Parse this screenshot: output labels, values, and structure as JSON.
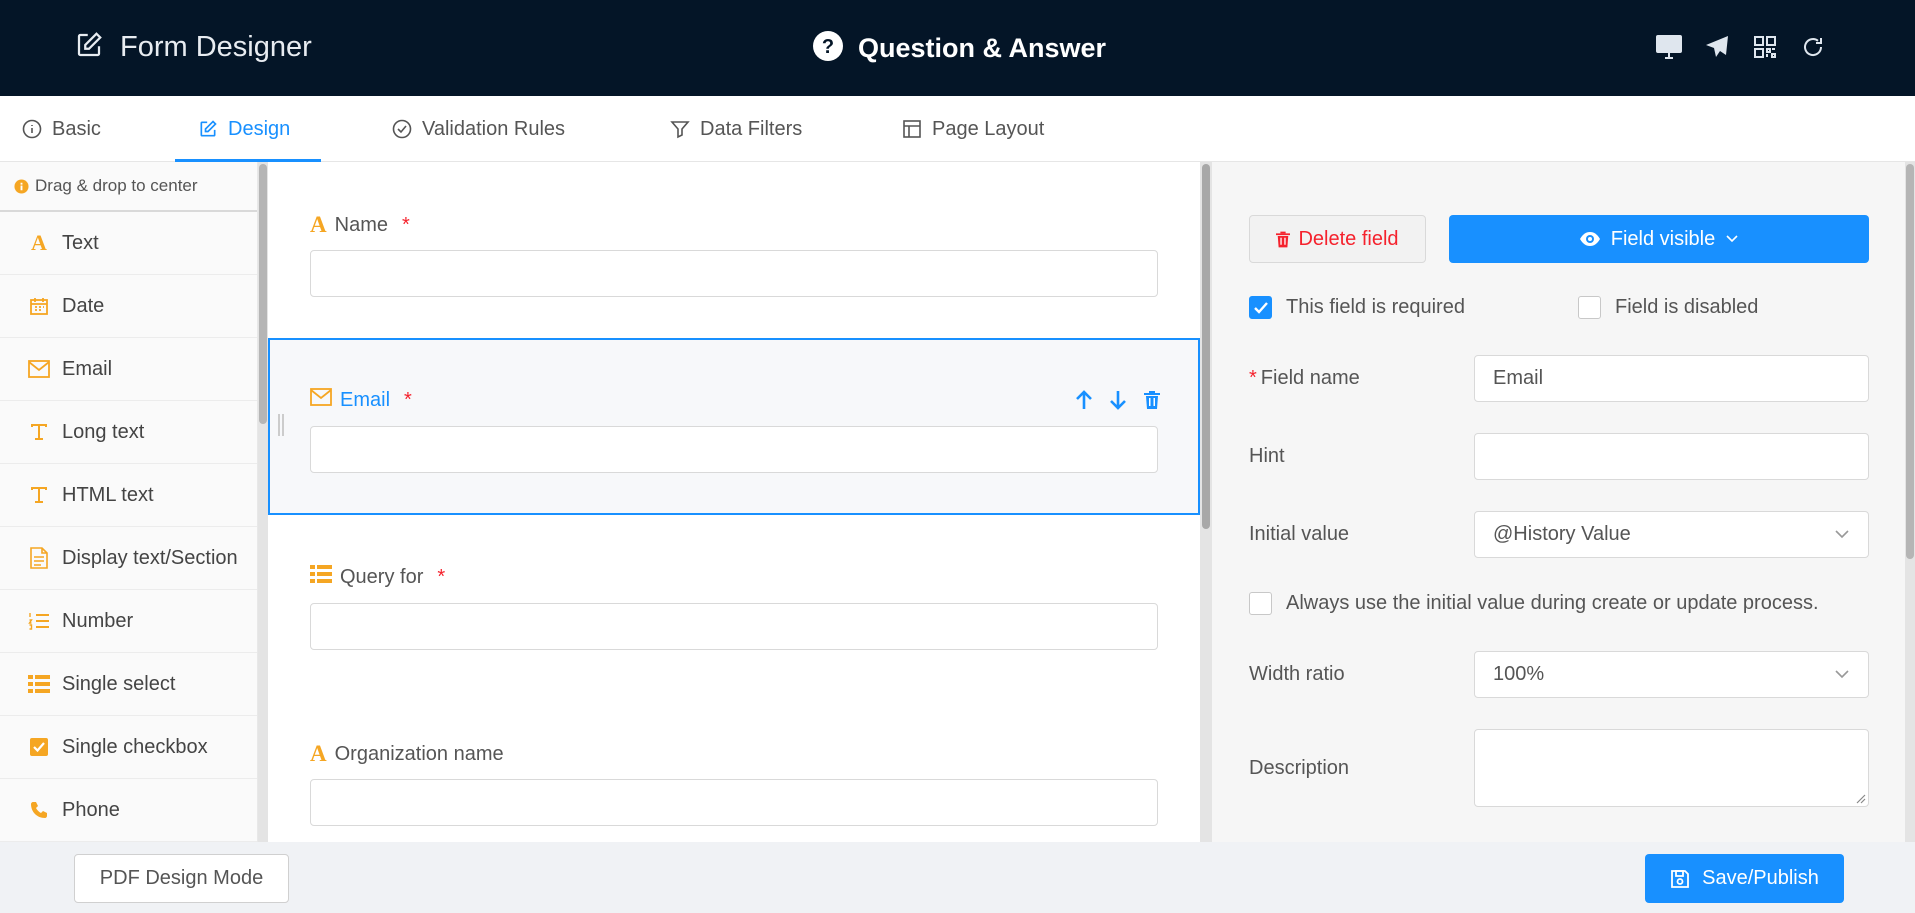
{
  "header": {
    "app_title": "Form Designer",
    "form_title": "Question & Answer",
    "tools": [
      "desktop-icon",
      "send-icon",
      "qrcode-icon",
      "refresh-icon"
    ]
  },
  "tabs": [
    {
      "label": "Basic",
      "icon": "info-icon"
    },
    {
      "label": "Design",
      "icon": "edit-icon",
      "active": true
    },
    {
      "label": "Validation Rules",
      "icon": "check-circle-icon"
    },
    {
      "label": "Data Filters",
      "icon": "filter-icon"
    },
    {
      "label": "Page Layout",
      "icon": "layout-icon"
    }
  ],
  "palette": {
    "hint": "Drag & drop to center",
    "items": [
      {
        "label": "Text",
        "icon": "font-icon"
      },
      {
        "label": "Date",
        "icon": "calendar-icon"
      },
      {
        "label": "Email",
        "icon": "mail-icon"
      },
      {
        "label": "Long text",
        "icon": "text-icon"
      },
      {
        "label": "HTML text",
        "icon": "text-icon"
      },
      {
        "label": "Display text/Section",
        "icon": "file-text-icon"
      },
      {
        "label": "Number",
        "icon": "ordered-list-icon"
      },
      {
        "label": "Single select",
        "icon": "list-icon"
      },
      {
        "label": "Single checkbox",
        "icon": "checkbox-icon"
      },
      {
        "label": "Phone",
        "icon": "phone-icon"
      }
    ]
  },
  "canvas": {
    "fields": [
      {
        "label": "Name",
        "required": "*",
        "icon": "font-icon"
      },
      {
        "label": "Email",
        "required": "*",
        "icon": "mail-icon",
        "selected": true
      },
      {
        "label": "Query for",
        "required": "*",
        "icon": "list-icon"
      },
      {
        "label": "Organization name",
        "required": "",
        "icon": "font-icon"
      }
    ]
  },
  "props": {
    "delete_label": "Delete field",
    "visible_label": "Field visible",
    "required_label": "This field is required",
    "required_checked": true,
    "disabled_label": "Field is disabled",
    "disabled_checked": false,
    "field_name_label": "Field name",
    "field_name_value": "Email",
    "hint_label": "Hint",
    "hint_value": "",
    "initial_value_label": "Initial value",
    "initial_value_value": "@History Value",
    "always_initial_label": "Always use the initial value during create or update process.",
    "always_initial_checked": false,
    "width_ratio_label": "Width ratio",
    "width_ratio_value": "100%",
    "description_label": "Description"
  },
  "footer": {
    "pdf_label": "PDF Design Mode",
    "save_label": "Save/Publish"
  },
  "colors": {
    "header_bg": "#041527",
    "accent": "#1890ff",
    "palette_icon": "#f5a623",
    "danger": "#f5222d"
  }
}
